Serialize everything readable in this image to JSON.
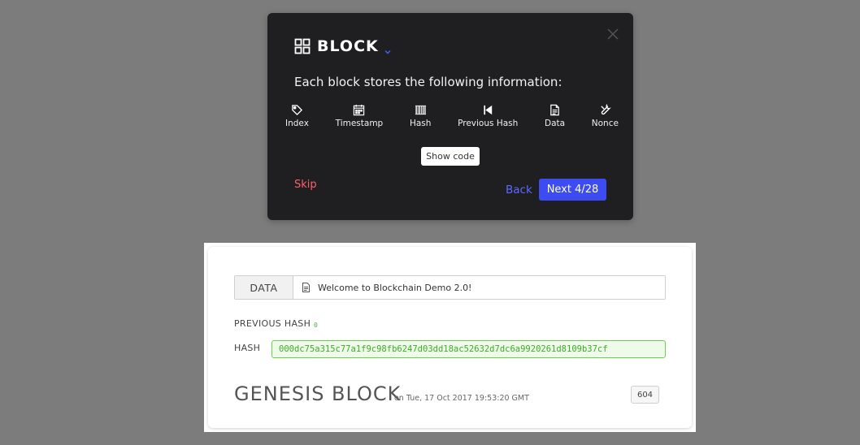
{
  "tour": {
    "title": "BLOCK",
    "description": "Each block stores the following information:",
    "fields": [
      {
        "label": "Index",
        "icon": "tag-icon"
      },
      {
        "label": "Timestamp",
        "icon": "calendar-icon"
      },
      {
        "label": "Hash",
        "icon": "barcode-icon"
      },
      {
        "label": "Previous Hash",
        "icon": "step-back-icon"
      },
      {
        "label": "Data",
        "icon": "document-icon"
      },
      {
        "label": "Nonce",
        "icon": "wrench-icon"
      }
    ],
    "show_code_label": "Show code",
    "skip_label": "Skip",
    "back_label": "Back",
    "next_label": "Next 4/28",
    "colors": {
      "skip": "#ff5f6d",
      "accent": "#3d4cf2",
      "background": "#1f1f22"
    }
  },
  "block": {
    "data_label": "DATA",
    "data_value": "Welcome to Blockchain Demo 2.0!",
    "previous_hash_label": "PREVIOUS HASH",
    "previous_hash_value": "0",
    "hash_label": "HASH",
    "hash_value": "000dc75a315c77a1f9c98fb6247d03dd18ac52632d7dc6a9920261d8109b37cf",
    "title": "GENESIS BLOCK",
    "timestamp": "on Tue, 17 Oct 2017 19:53:20 GMT",
    "nonce": "604",
    "colors": {
      "hash_green": "#3faa2b"
    }
  }
}
